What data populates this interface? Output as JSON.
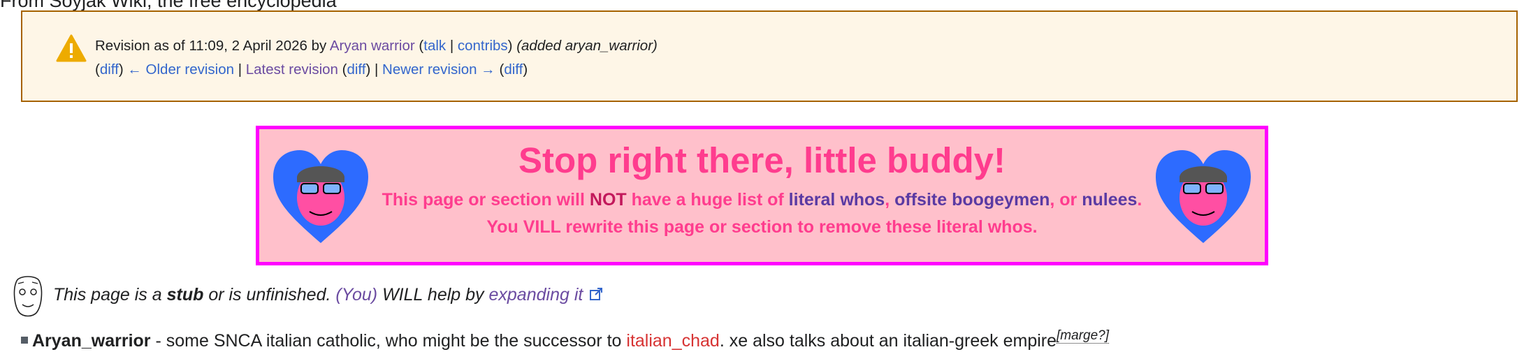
{
  "site_sub": "From Soyjak Wiki, the free encyclopedia",
  "revision": {
    "prefix": "Revision as of 11:09, 2 April 2026 by",
    "user": "Aryan warrior",
    "open_paren": " (",
    "talk": "talk",
    "sep": " | ",
    "contribs": "contribs",
    "close_paren": ")",
    "summary": "(added aryan_warrior)",
    "diff": "diff",
    "older": "← Older revision",
    "latest": "Latest revision",
    "newer": "Newer revision →"
  },
  "banner": {
    "title": "Stop right there, little buddy!",
    "line1_a": "This page or section will ",
    "line1_not": "NOT",
    "line1_b": " have a huge list of ",
    "link1": "literal whos",
    "comma": ", ",
    "link2": "offsite boogeymen",
    "or": ", or ",
    "link3": "nulees",
    "period": ".",
    "line2": "You VILL rewrite this page or section to remove these literal whos."
  },
  "stub": {
    "a": "This page is a ",
    "b": "stub",
    "c": " or is unfinished. ",
    "you": "(You)",
    "d": " WILL help by ",
    "link": "expanding it"
  },
  "entry": {
    "name": "Aryan_warrior",
    "text_a": " - some SNCA italian catholic, who might be the successor to ",
    "link": "italian_chad",
    "text_b": ". xe also talks about an italian-greek empire",
    "sup": "[marge?]"
  },
  "colors": {
    "banner_bg": "#ffc0cb",
    "banner_border": "#ff00ff",
    "banner_text": "#ff3c8e",
    "revbox_bg": "#fef6e7",
    "link": "#3366cc"
  },
  "icons": [
    "warning-icon",
    "aryan-heart-icon",
    "soyjak-stub-icon",
    "external-link-icon"
  ]
}
